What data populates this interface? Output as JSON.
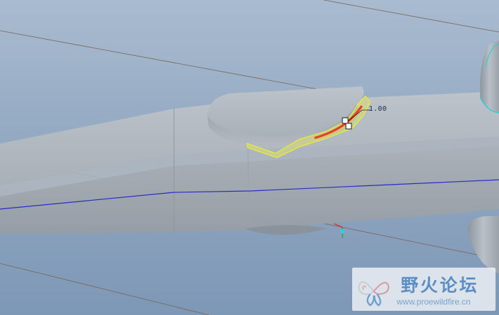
{
  "viewport": {
    "dimension_value": "1.00"
  },
  "watermark": {
    "title": "野火论坛",
    "url": "www.proewildfire.cn",
    "logo_icon": "butterfly-logo-icon"
  },
  "colors": {
    "background_top": "#a9bbd0",
    "background_bottom": "#7d97b6",
    "part_face": "#a2aab2",
    "part_top": "#b7bec6",
    "highlight_yellow": "#e8ea3a",
    "preview_red": "#e8401c",
    "edge_blue": "#2a2ac8",
    "datum_line": "#7a5a4a",
    "cyan_edge": "#20d0d8"
  }
}
